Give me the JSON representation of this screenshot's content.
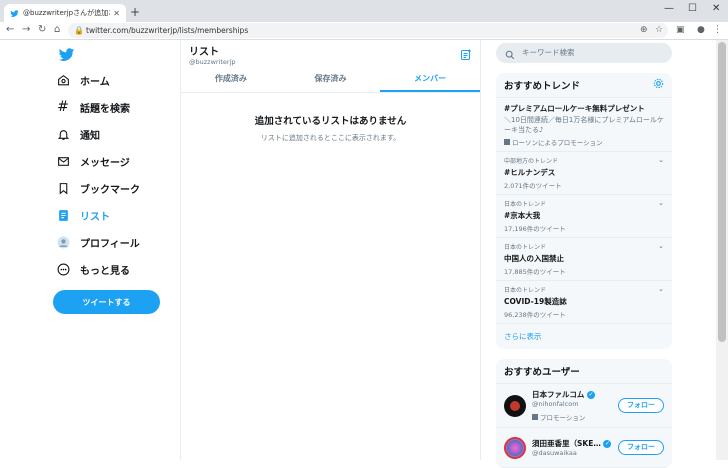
{
  "browser": {
    "tab_title": "@buzzwriterjpさんが追加されてい",
    "url": "twitter.com/buzzwriterjp/lists/memberships"
  },
  "nav": {
    "items": [
      {
        "label": "ホーム",
        "icon": "home-icon"
      },
      {
        "label": "話題を検索",
        "icon": "hashtag-icon"
      },
      {
        "label": "通知",
        "icon": "bell-icon"
      },
      {
        "label": "メッセージ",
        "icon": "mail-icon"
      },
      {
        "label": "ブックマーク",
        "icon": "bookmark-icon"
      },
      {
        "label": "リスト",
        "icon": "list-icon"
      },
      {
        "label": "プロフィール",
        "icon": "avatar-icon"
      },
      {
        "label": "もっと見る",
        "icon": "more-icon"
      }
    ],
    "tweet_button": "ツイートする"
  },
  "main": {
    "title": "リスト",
    "subtitle": "@buzzwriterjp",
    "tabs": [
      "作成済み",
      "保存済み",
      "メンバー"
    ],
    "empty_title": "追加されているリストはありません",
    "empty_sub": "リストに追加されるとここに表示されます。"
  },
  "right": {
    "search_placeholder": "キーワード検索",
    "trends_title": "おすすめトレンド",
    "trends": [
      {
        "context": "",
        "name": "#プレミアムロールケーキ無料プレゼント",
        "desc": "＼10日間連続／毎日1万名様にプレミアムロールケーキ当たる♪",
        "promo": "ローソンによるプロモーション",
        "count": ""
      },
      {
        "context": "中部地方のトレンド",
        "name": "#ヒルナンデス",
        "desc": "",
        "promo": "",
        "count": "2,071件のツイート"
      },
      {
        "context": "日本のトレンド",
        "name": "#京本大我",
        "desc": "",
        "promo": "",
        "count": "17,196件のツイート"
      },
      {
        "context": "日本のトレンド",
        "name": "中国人の入国禁止",
        "desc": "",
        "promo": "",
        "count": "17,885件のツイート"
      },
      {
        "context": "日本のトレンド",
        "name": "COVID-19製造誌",
        "desc": "",
        "promo": "",
        "count": "96,238件のツイート"
      }
    ],
    "show_more": "さらに表示",
    "users_title": "おすすめユーザー",
    "users": [
      {
        "name": "日本ファルコム",
        "handle": "@nihonfalcom",
        "promo": "プロモーション",
        "follow": "フォロー"
      },
      {
        "name": "須田亜香里（SKE…",
        "handle": "@dasuwaikaa",
        "promo": "",
        "follow": "フォロー"
      }
    ]
  },
  "colors": {
    "accent": "#1da1f2"
  }
}
